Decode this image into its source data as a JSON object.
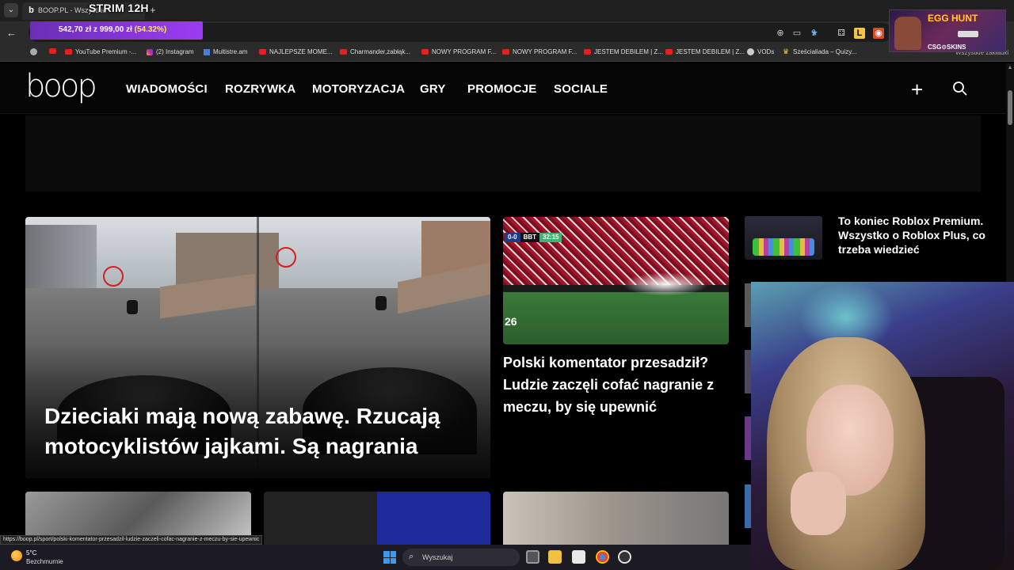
{
  "browser": {
    "tab_title": "BOOP.PL - Wszystkie",
    "overlay_title": "STRIM 12H",
    "donation_amount": "542,70 zł",
    "donation_goal_text": "z 999,00 zł",
    "donation_pct": "(54.32%)",
    "donation_progress": 0.5432,
    "bookmarks": [
      {
        "label": "YouTube Premium -...",
        "icon": "youtube-icon"
      },
      {
        "label": "(2) Instagram",
        "icon": "instagram-icon"
      },
      {
        "label": "Multistre.am",
        "icon": "multistream-icon"
      },
      {
        "label": "NAJLEPSZE MOME...",
        "icon": "youtube-icon"
      },
      {
        "label": "Charmander,zabłąk...",
        "icon": "youtube-icon"
      },
      {
        "label": "NOWY PROGRAM F...",
        "icon": "youtube-icon"
      },
      {
        "label": "NOWY PROGRAM F...",
        "icon": "youtube-icon"
      },
      {
        "label": "JESTEM DEBILEM | Z...",
        "icon": "youtube-icon"
      },
      {
        "label": "JESTEM DEBILEM | Z...",
        "icon": "youtube-icon"
      },
      {
        "label": "VODs",
        "icon": "globe-icon"
      },
      {
        "label": "Sześcialiada – Quizy...",
        "icon": "quiz-icon"
      }
    ],
    "all_bookmarks": "Wszystkie zakładki",
    "egg_hunt_title": "EGG HUNT",
    "egg_hunt_sub": "CSG⊙SKINS"
  },
  "site": {
    "logo": "boop",
    "nav": [
      "WIADOMOŚCI",
      "ROZRYWKA",
      "MOTORYZACJA",
      "GRY",
      "PROMOCJE",
      "SOCIALE"
    ]
  },
  "articles": {
    "feature_title": "Dzieciaki mają nową zabawę. Rzucają motocyklistów jajkami. Są nagrania",
    "second_title": "Polski komentator przesadził? Ludzie zaczęli cofać nagranie z meczu, by się upewnić",
    "second_score": "0-0",
    "second_team": "BBT",
    "second_time": "32:15",
    "second_num": "26",
    "side_title": "To koniec Roblox Premium. Wszystko o Roblox Plus, co trzeba wiedzieć"
  },
  "status_url": "https://boop.pl/sport/polski-komentator-przesadzil-ludzie-zaczeli-cofac-nagranie-z-meczu-by-sie-upewnic",
  "taskbar": {
    "temp": "5°C",
    "weather": "Bezchmurnie",
    "search_placeholder": "Wyszukaj"
  }
}
